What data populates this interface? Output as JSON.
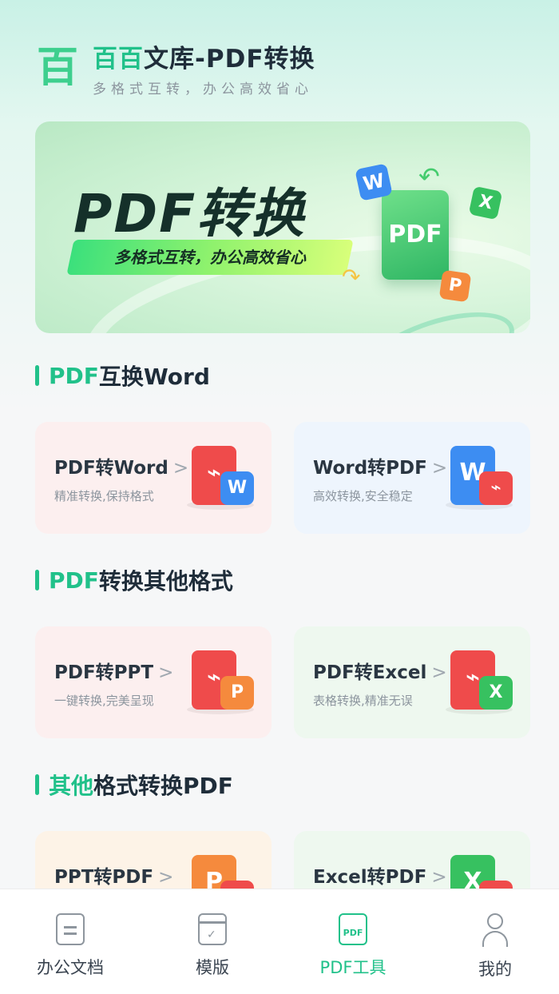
{
  "header": {
    "title_accent": "百百",
    "title_rest": "文库-PDF转换",
    "subtitle": "多格式互转，办公高效省心",
    "logo_char": "百"
  },
  "banner": {
    "title": "PDF转换",
    "tagline": "多格式互转，办公高效省心",
    "doc_label": "PDF",
    "chips": [
      "W",
      "X",
      "P"
    ]
  },
  "sections": [
    {
      "title_accent": "PDF",
      "title_rest": "互换Word"
    },
    {
      "title_accent": "PDF",
      "title_rest": "转换其他格式"
    },
    {
      "title_accent": "其他",
      "title_rest": "格式转换PDF"
    }
  ],
  "cards": [
    {
      "title": "PDF转Word",
      "subtitle": "精准转换,保持格式",
      "doc_color": "#ef4b4b",
      "badge": "W",
      "badge_color": "#3d8df2",
      "bg": "#fcefef"
    },
    {
      "title": "Word转PDF",
      "subtitle": "高效转换,安全稳定",
      "doc_color": "#3d8df2",
      "badge": "",
      "badge_color": "#ef4b4b",
      "bg": "#eef5fd"
    },
    {
      "title": "PDF转PPT",
      "subtitle": "一键转换,完美呈现",
      "doc_color": "#ef4b4b",
      "badge": "P",
      "badge_color": "#f58a3d",
      "bg": "#fcefef"
    },
    {
      "title": "PDF转Excel",
      "subtitle": "表格转换,精准无误",
      "doc_color": "#ef4b4b",
      "badge": "X",
      "badge_color": "#37c160",
      "bg": "#eef8ef"
    },
    {
      "title": "PPT转PDF",
      "subtitle": "",
      "doc_color": "#f58a3d",
      "badge": "",
      "badge_color": "#ef4b4b",
      "bg": "#fdf3e7"
    },
    {
      "title": "Excel转PDF",
      "subtitle": "",
      "doc_color": "#37c160",
      "badge": "",
      "badge_color": "#ef4b4b",
      "bg": "#eef8ef"
    }
  ],
  "chevron": ">",
  "tabbar": [
    {
      "label": "办公文档",
      "icon": "document-icon",
      "active": false
    },
    {
      "label": "模版",
      "icon": "template-icon",
      "active": false
    },
    {
      "label": "PDF工具",
      "icon": "pdf-icon",
      "active": true
    },
    {
      "label": "我的",
      "icon": "profile-icon",
      "active": false
    }
  ],
  "colors": {
    "accent": "#21c18a"
  }
}
